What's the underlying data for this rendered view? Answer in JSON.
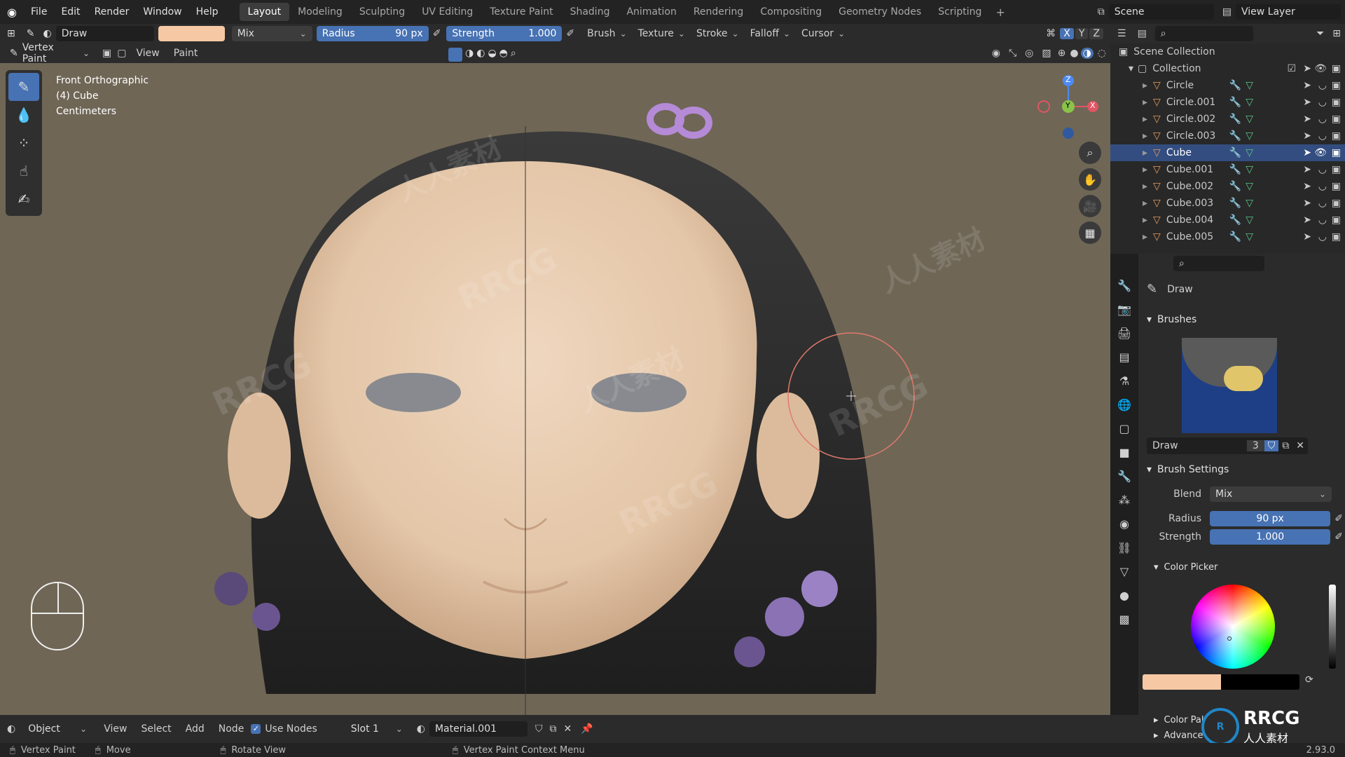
{
  "menubar": {
    "logo": "RRCG",
    "menus": [
      "File",
      "Edit",
      "Render",
      "Window",
      "Help"
    ],
    "workspaces": [
      "Layout",
      "Modeling",
      "Sculpting",
      "UV Editing",
      "Texture Paint",
      "Shading",
      "Animation",
      "Rendering",
      "Compositing",
      "Geometry Nodes",
      "Scripting"
    ],
    "active_workspace": "Layout",
    "scene": "Scene",
    "view_layer": "View Layer"
  },
  "toolheader": {
    "brush_name": "Draw",
    "brush_color": "#f6c9a4",
    "blend": "Mix",
    "radius_label": "Radius",
    "radius_value": "90 px",
    "strength_label": "Strength",
    "strength_value": "1.000",
    "menus": [
      "Brush",
      "Texture",
      "Stroke",
      "Falloff",
      "Cursor"
    ],
    "axes": [
      "X",
      "Y",
      "Z"
    ]
  },
  "modeheader": {
    "mode": "Vertex Paint",
    "menus": [
      "View",
      "Paint"
    ]
  },
  "viewport": {
    "view_name": "Front Orthographic",
    "object": "(4) Cube",
    "units": "Centimeters",
    "gizmo": {
      "z": "Z",
      "y": "Y",
      "x": "X"
    }
  },
  "outliner": {
    "root": "Scene Collection",
    "collection": "Collection",
    "items": [
      {
        "name": "Circle",
        "selected": false
      },
      {
        "name": "Circle.001",
        "selected": false
      },
      {
        "name": "Circle.002",
        "selected": false
      },
      {
        "name": "Circle.003",
        "selected": false
      },
      {
        "name": "Cube",
        "selected": true
      },
      {
        "name": "Cube.001",
        "selected": false
      },
      {
        "name": "Cube.002",
        "selected": false
      },
      {
        "name": "Cube.003",
        "selected": false
      },
      {
        "name": "Cube.004",
        "selected": false
      },
      {
        "name": "Cube.005",
        "selected": false
      }
    ]
  },
  "properties": {
    "tool_name": "Draw",
    "brushes_panel": "Brushes",
    "brush_name": "Draw",
    "brush_users": "3",
    "brush_settings_panel": "Brush Settings",
    "blend_label": "Blend",
    "blend_value": "Mix",
    "radius_label": "Radius",
    "radius_value": "90 px",
    "strength_label": "Strength",
    "strength_value": "1.000",
    "color_picker_panel": "Color Picker",
    "primary_color": "#f6c9a4",
    "secondary_color": "#000000",
    "color_palette_panel": "Color Pal",
    "advanced_panel": "Advance"
  },
  "bottomheader": {
    "mode": "Object",
    "menus": [
      "View",
      "Select",
      "Add",
      "Node"
    ],
    "use_nodes_label": "Use Nodes",
    "slot": "Slot 1",
    "material": "Material.001"
  },
  "statusbar": {
    "item1": "Vertex Paint",
    "item2": "Move",
    "item3": "Rotate View",
    "item4": "Vertex Paint Context Menu",
    "version": "2.93.0"
  },
  "watermark_text": "RRCG",
  "watermark_sub": "人人素材"
}
